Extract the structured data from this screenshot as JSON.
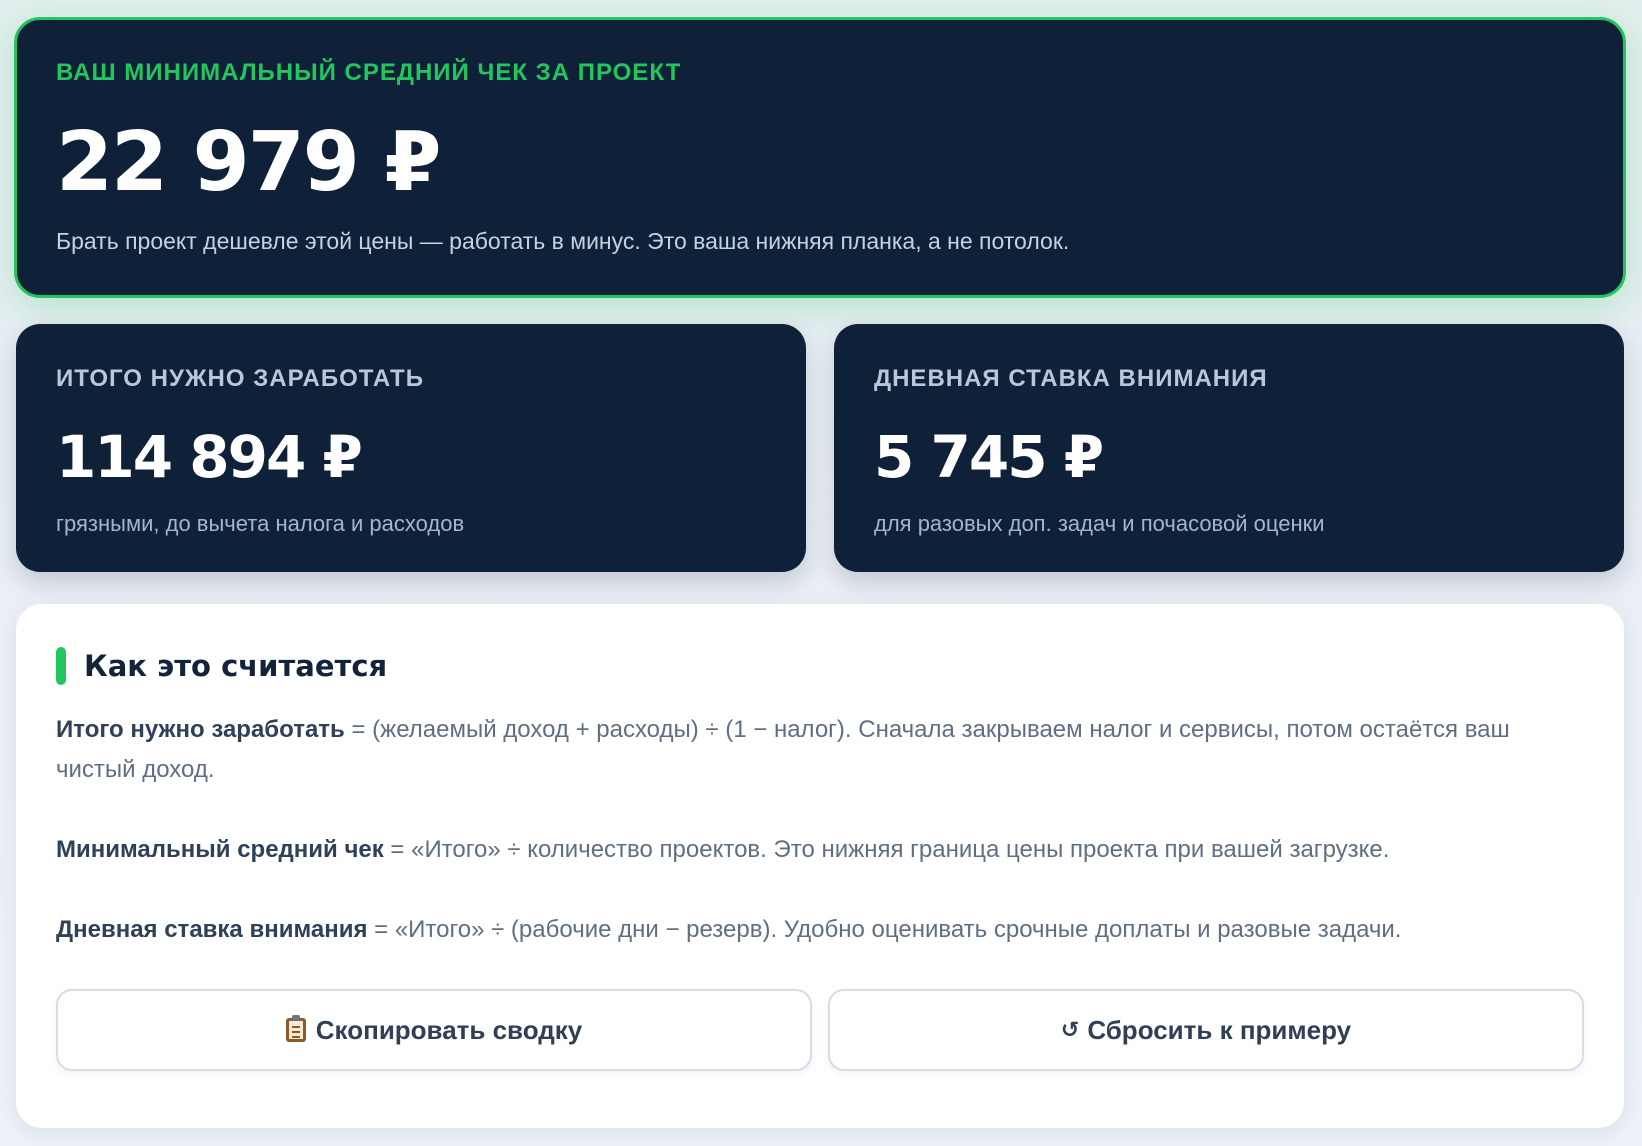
{
  "hero": {
    "label": "ВАШ МИНИМАЛЬНЫЙ СРЕДНИЙ ЧЕК ЗА ПРОЕКТ",
    "value": "22 979 ₽",
    "note": "Брать проект дешевле этой цены — работать в минус. Это ваша нижняя планка, а не потолок."
  },
  "total": {
    "label": "ИТОГО НУЖНО ЗАРАБОТАТЬ",
    "value": "114 894 ₽",
    "note": "грязными, до вычета налога и расходов"
  },
  "daily": {
    "label": "ДНЕВНАЯ СТАВКА ВНИМАНИЯ",
    "value": "5 745 ₽",
    "note": "для разовых доп. задач и почасовой оценки"
  },
  "info": {
    "title": "Как это считается",
    "p1_term": "Итого нужно заработать",
    "p1_text": " = (желаемый доход + расходы) ÷ (1 − налог). Сначала закрываем налог и сервисы, потом остаётся ваш чистый доход.",
    "p2_term": "Минимальный средний чек",
    "p2_text": " = «Итого» ÷ количество проектов. Это нижняя граница цены проекта при вашей загрузке.",
    "p3_term": "Дневная ставка внимания",
    "p3_text": " = «Итого» ÷ (рабочие дни − резерв). Удобно оценивать срочные доплаты и разовые задачи."
  },
  "buttons": {
    "copy_label": "Скопировать сводку",
    "reset_glyph": "↺",
    "reset_label": "Сбросить к примеру"
  },
  "icons": {
    "copy": "clipboard-icon",
    "reset": "reset-icon"
  },
  "colors": {
    "accent": "#22c55e",
    "card_dark": "#0f2139"
  }
}
